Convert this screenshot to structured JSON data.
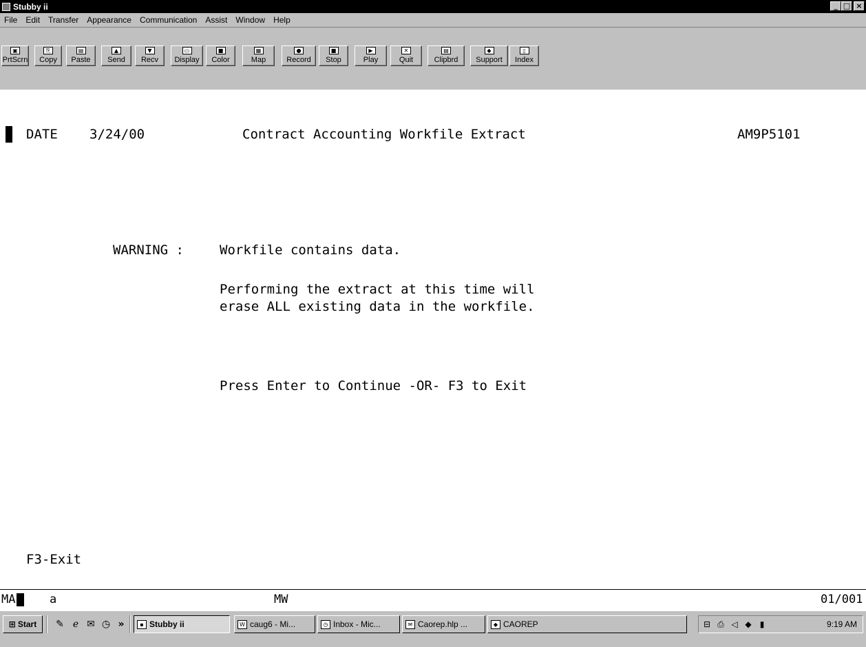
{
  "window": {
    "title": "Stubby ii",
    "buttons": {
      "minimize": "_",
      "maximize": "□",
      "close": "×"
    }
  },
  "menu": [
    "File",
    "Edit",
    "Transfer",
    "Appearance",
    "Communication",
    "Assist",
    "Window",
    "Help"
  ],
  "toolbar": [
    {
      "label": "PrtScrn",
      "icon": "print-screen-icon"
    },
    {
      "label": "Copy",
      "icon": "copy-icon"
    },
    {
      "label": "Paste",
      "icon": "paste-icon"
    },
    {
      "label": "Send",
      "icon": "send-icon"
    },
    {
      "label": "Recv",
      "icon": "receive-icon"
    },
    {
      "label": "Display",
      "icon": "display-icon"
    },
    {
      "label": "Color",
      "icon": "color-icon"
    },
    {
      "label": "Map",
      "icon": "map-icon"
    },
    {
      "label": "Record",
      "icon": "record-icon"
    },
    {
      "label": "Stop",
      "icon": "stop-icon"
    },
    {
      "label": "Play",
      "icon": "play-icon"
    },
    {
      "label": "Quit",
      "icon": "quit-icon"
    },
    {
      "label": "Clipbrd",
      "icon": "clipboard-icon"
    },
    {
      "label": "Support",
      "icon": "support-icon"
    },
    {
      "label": "Index",
      "icon": "index-icon"
    }
  ],
  "screen": {
    "date_label": "DATE",
    "date_value": "3/24/00",
    "title": "Contract Accounting Workfile Extract",
    "program_id": "AM9P5101",
    "warning_label": "WARNING :",
    "warning_text": "Workfile contains data.",
    "detail_line1": "Performing the extract at this time will",
    "detail_line2": "erase ALL existing data in the workfile.",
    "prompt": "Press Enter to Continue -OR- F3 to Exit",
    "footer_keys": "F3-Exit"
  },
  "oia": {
    "left": "MA",
    "mode": "a",
    "workstation": "MW",
    "position": "01/001"
  },
  "taskbar": {
    "start": "Start",
    "quick_launch": [
      "desktop-icon",
      "internet-explorer-icon",
      "outlook-icon",
      "clock-app-icon"
    ],
    "more": "»",
    "tasks": [
      {
        "label": "Stubby ii",
        "active": true,
        "icon": "terminal-icon"
      },
      {
        "label": "caug6 - Mi...",
        "active": false,
        "icon": "word-icon"
      },
      {
        "label": "Inbox - Mic...",
        "active": false,
        "icon": "inbox-icon"
      },
      {
        "label": "Caorep.hlp ...",
        "active": false,
        "icon": "envelope-icon"
      },
      {
        "label": "CAOREP",
        "active": false,
        "icon": "app-icon"
      }
    ],
    "clock": "9:19 AM"
  }
}
